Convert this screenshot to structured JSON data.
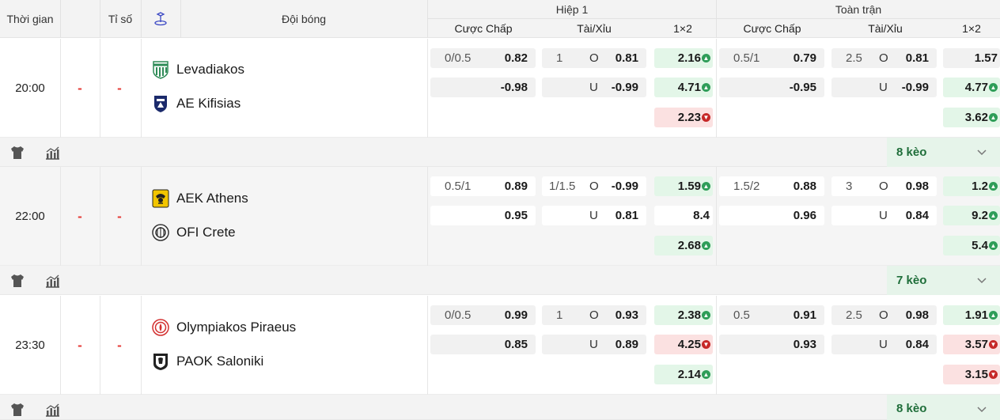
{
  "header": {
    "time": "Thời gian",
    "score": "Tỉ số",
    "team": "Đội bóng",
    "half1": "Hiệp 1",
    "fulltime": "Toàn trận",
    "handicap": "Cược Chấp",
    "overunder": "Tài/Xỉu",
    "onextwo": "1×2"
  },
  "matches": [
    {
      "time": "20:00",
      "score_home": "-",
      "score_away": "-",
      "home": "Levadiakos",
      "away": "AE Kifisias",
      "h1": {
        "hdp": [
          "0/0.5",
          "0.82",
          "",
          "-0.98"
        ],
        "ou": [
          "1",
          "O",
          "0.81",
          "",
          "U",
          "-0.99"
        ],
        "x12": [
          {
            "v": "2.16",
            "d": "up"
          },
          {
            "v": "4.71",
            "d": "up"
          },
          {
            "v": "2.23",
            "d": "down"
          }
        ]
      },
      "ft": {
        "hdp": [
          "0.5/1",
          "0.79",
          "",
          "-0.95"
        ],
        "ou": [
          "2.5",
          "O",
          "0.81",
          "",
          "U",
          "-0.99"
        ],
        "x12": [
          {
            "v": "1.57",
            "d": "flat"
          },
          {
            "v": "4.77",
            "d": "up"
          },
          {
            "v": "3.62",
            "d": "up"
          }
        ]
      },
      "keo": "8 kèo"
    },
    {
      "time": "22:00",
      "score_home": "-",
      "score_away": "-",
      "home": "AEK Athens",
      "away": "OFI Crete",
      "h1": {
        "hdp": [
          "0.5/1",
          "0.89",
          "",
          "0.95"
        ],
        "ou": [
          "1/1.5",
          "O",
          "-0.99",
          "",
          "U",
          "0.81"
        ],
        "x12": [
          {
            "v": "1.59",
            "d": "up"
          },
          {
            "v": "8.4",
            "d": "flat"
          },
          {
            "v": "2.68",
            "d": "up"
          }
        ]
      },
      "ft": {
        "hdp": [
          "1.5/2",
          "0.88",
          "",
          "0.96"
        ],
        "ou": [
          "3",
          "O",
          "0.98",
          "",
          "U",
          "0.84"
        ],
        "x12": [
          {
            "v": "1.2",
            "d": "up"
          },
          {
            "v": "9.2",
            "d": "up"
          },
          {
            "v": "5.4",
            "d": "up"
          }
        ]
      },
      "keo": "7 kèo"
    },
    {
      "time": "23:30",
      "score_home": "-",
      "score_away": "-",
      "home": "Olympiakos Piraeus",
      "away": "PAOK Saloniki",
      "h1": {
        "hdp": [
          "0/0.5",
          "0.99",
          "",
          "0.85"
        ],
        "ou": [
          "1",
          "O",
          "0.93",
          "",
          "U",
          "0.89"
        ],
        "x12": [
          {
            "v": "2.38",
            "d": "up"
          },
          {
            "v": "4.25",
            "d": "down"
          },
          {
            "v": "2.14",
            "d": "up"
          }
        ]
      },
      "ft": {
        "hdp": [
          "0.5",
          "0.91",
          "",
          "0.93"
        ],
        "ou": [
          "2.5",
          "O",
          "0.98",
          "",
          "U",
          "0.84"
        ],
        "x12": [
          {
            "v": "1.91",
            "d": "up"
          },
          {
            "v": "3.57",
            "d": "down"
          },
          {
            "v": "3.15",
            "d": "down"
          }
        ]
      },
      "keo": "8 kèo"
    }
  ],
  "icons": {
    "shirt": "shirt-icon",
    "stats": "stats-icon",
    "chevron": "chevron-down-icon",
    "stadium": "stadium-icon"
  },
  "colors": {
    "up": "#2e9d58",
    "down": "#c62828",
    "upBg": "#e3f6e8",
    "downBg": "#fbe1e1",
    "score": "#e53935",
    "keo": "#1f6e3a"
  }
}
